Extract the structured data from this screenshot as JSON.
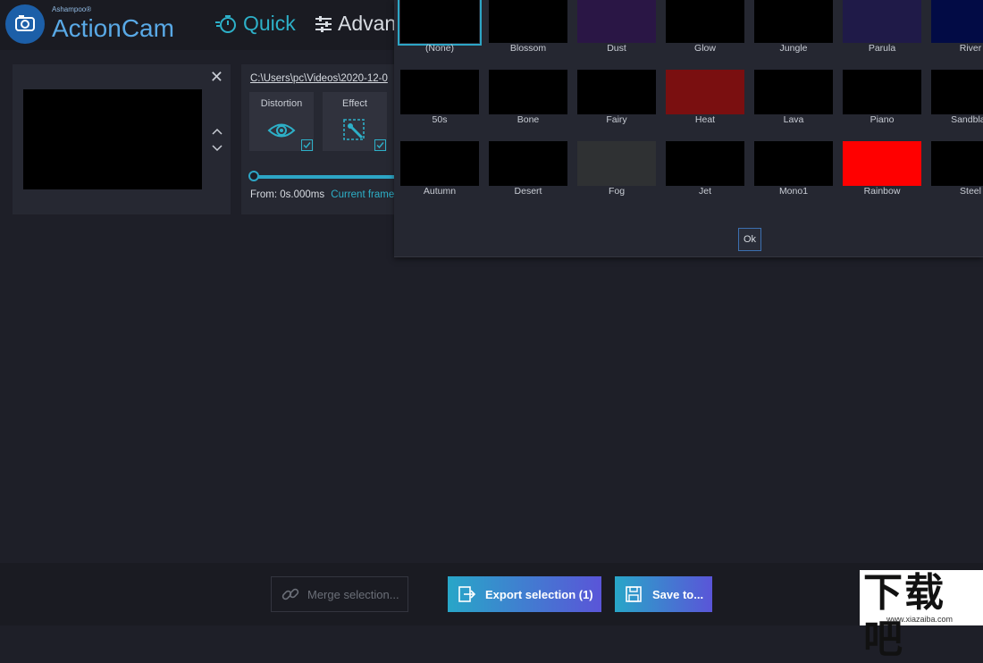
{
  "brand": {
    "maker": "Ashampoo®",
    "name": "ActionCam"
  },
  "nav": {
    "quick": "Quick",
    "advanced": "Advan"
  },
  "clip": {
    "close": "✕"
  },
  "edit": {
    "path": "C:\\Users\\pc\\Videos\\2020-12-0",
    "tools": [
      {
        "label": "Distortion"
      },
      {
        "label": "Effect"
      }
    ],
    "from_label": "From:",
    "from_value": "0s.000ms",
    "current_frame": "Current frame"
  },
  "effects": [
    {
      "name": "(None)",
      "color": "#000000",
      "selected": true
    },
    {
      "name": "Blossom",
      "color": "#000000"
    },
    {
      "name": "Dust",
      "color": "#2a1645"
    },
    {
      "name": "Glow",
      "color": "#000000"
    },
    {
      "name": "Jungle",
      "color": "#000000"
    },
    {
      "name": "Parula",
      "color": "#1f1a48"
    },
    {
      "name": "River",
      "color": "#020b45"
    },
    {
      "name": "50s",
      "color": "#000000"
    },
    {
      "name": "Bone",
      "color": "#000000"
    },
    {
      "name": "Fairy",
      "color": "#000000"
    },
    {
      "name": "Heat",
      "color": "#7a0f10"
    },
    {
      "name": "Lava",
      "color": "#000000"
    },
    {
      "name": "Piano",
      "color": "#000000"
    },
    {
      "name": "Sandblas",
      "color": "#000000"
    },
    {
      "name": "Autumn",
      "color": "#000000"
    },
    {
      "name": "Desert",
      "color": "#000000"
    },
    {
      "name": "Fog",
      "color": "#2f3133"
    },
    {
      "name": "Jet",
      "color": "#000000"
    },
    {
      "name": "Mono1",
      "color": "#000000"
    },
    {
      "name": "Rainbow",
      "color": "#ff0000"
    },
    {
      "name": "Steel",
      "color": "#000000"
    }
  ],
  "popup": {
    "ok": "Ok"
  },
  "bottom": {
    "merge": "Merge selection...",
    "export": "Export selection (1)",
    "save": "Save to..."
  },
  "watermark": {
    "chars": "下载吧",
    "url": "www.xiazaiba.com"
  },
  "colors": {
    "accent": "#2db0c8",
    "brand_blue": "#59a9e6",
    "gradient_end": "#5a55d8"
  }
}
